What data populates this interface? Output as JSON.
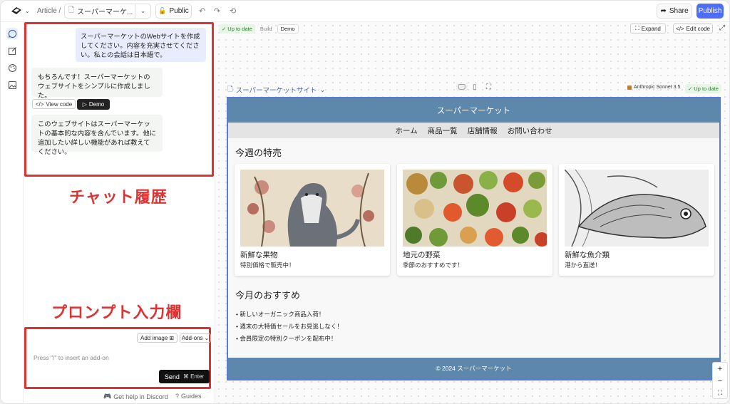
{
  "topbar": {
    "breadcrumb": "Article /",
    "artifact_name": "スーパーマーケ...",
    "visibility": "Public",
    "share": "Share",
    "publish": "Publish"
  },
  "chat": {
    "user_message": "スーパーマーケットのWebサイトを作成してください。内容を充実させてください。私との会話は日本語で。",
    "bot_message_1": "もちろんです！スーパーマーケットのウェブサイトをシンプルに作成しました。",
    "view_code": "View code",
    "demo": "Demo",
    "bot_message_2": "このウェブサイトはスーパーマーケットの基本的な内容を含んでいます。他に追加したい詳しい機能があれば教えてください。"
  },
  "annotations": {
    "chat_history": "チャット履歴",
    "prompt_input": "プロンプト入力欄"
  },
  "prompt": {
    "add_image": "Add image",
    "add_ons": "Add-ons",
    "placeholder": "Press \"/\" to insert an add-on",
    "send": "Send",
    "shortcut": "⌘ Enter"
  },
  "footer_links": {
    "discord": "Get help in Discord",
    "guides": "Guides"
  },
  "canvas": {
    "status": "Up to date",
    "build": "Build",
    "demo": "Demo",
    "expand": "Expand",
    "edit_code": "Edit code",
    "site_name": "スーパーマーケットサイト",
    "model": "Anthropic Sonnet 3.5",
    "model_status": "Up to date"
  },
  "site": {
    "header": "スーパーマーケット",
    "nav": [
      "ホーム",
      "商品一覧",
      "店舗情報",
      "お問い合わせ"
    ],
    "weekly_title": "今週の特売",
    "cards": [
      {
        "title": "新鮮な果物",
        "sub": "特別価格で販売中！"
      },
      {
        "title": "地元の野菜",
        "sub": "季節のおすすめです！"
      },
      {
        "title": "新鮮な魚介類",
        "sub": "港から直送！"
      }
    ],
    "monthly_title": "今月のおすすめ",
    "recommendations": [
      "新しいオーガニック商品入荷！",
      "週末の大特価セールをお見逃しなく！",
      "会員限定の特別クーポンを配布中！"
    ],
    "footer": "© 2024 スーパーマーケット"
  },
  "colors": {
    "accent": "#4f6ef7",
    "site_header": "#5e88ab",
    "annotation_red": "#dd3333"
  }
}
